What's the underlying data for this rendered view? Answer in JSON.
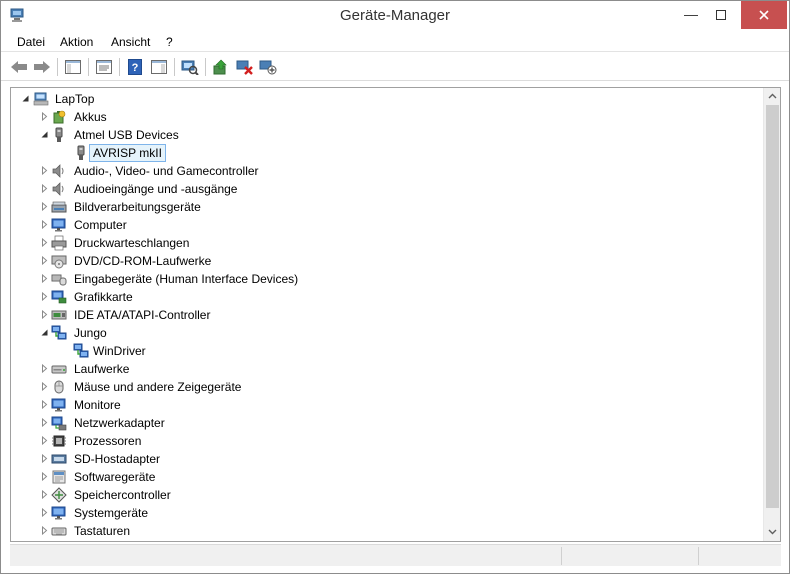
{
  "window": {
    "title": "Geräte-Manager",
    "accent": "#c75050"
  },
  "menu": [
    {
      "label": "Datei"
    },
    {
      "label": "Aktion"
    },
    {
      "label": "Ansicht"
    },
    {
      "label": "?"
    }
  ],
  "toolbar": [
    {
      "name": "back-arrow-icon"
    },
    {
      "name": "forward-arrow-icon"
    },
    {
      "name": "show-hide-console-tree-icon"
    },
    {
      "name": "properties-icon"
    },
    {
      "name": "help-icon"
    },
    {
      "name": "action-pane-icon"
    },
    {
      "name": "scan-hardware-icon"
    },
    {
      "name": "update-driver-icon"
    },
    {
      "name": "uninstall-device-icon"
    },
    {
      "name": "add-legacy-hardware-icon"
    }
  ],
  "tree": [
    {
      "label": "LapTop",
      "level": 0,
      "state": "expanded",
      "icon": "computer-icon"
    },
    {
      "label": "Akkus",
      "level": 1,
      "state": "collapsed",
      "icon": "battery-icon"
    },
    {
      "label": "Atmel USB Devices",
      "level": 1,
      "state": "expanded",
      "icon": "usb-device-icon"
    },
    {
      "label": "AVRISP mkII",
      "level": 2,
      "state": "leaf",
      "icon": "usb-device-icon",
      "selected": true
    },
    {
      "label": "Audio-, Video- und Gamecontroller",
      "level": 1,
      "state": "collapsed",
      "icon": "speaker-icon"
    },
    {
      "label": "Audioeingänge und -ausgänge",
      "level": 1,
      "state": "collapsed",
      "icon": "speaker-icon"
    },
    {
      "label": "Bildverarbeitungsgeräte",
      "level": 1,
      "state": "collapsed",
      "icon": "scanner-icon"
    },
    {
      "label": "Computer",
      "level": 1,
      "state": "collapsed",
      "icon": "monitor-icon"
    },
    {
      "label": "Druckwarteschlangen",
      "level": 1,
      "state": "collapsed",
      "icon": "printer-icon"
    },
    {
      "label": "DVD/CD-ROM-Laufwerke",
      "level": 1,
      "state": "collapsed",
      "icon": "disc-drive-icon"
    },
    {
      "label": "Eingabegeräte (Human Interface Devices)",
      "level": 1,
      "state": "collapsed",
      "icon": "hid-icon"
    },
    {
      "label": "Grafikkarte",
      "level": 1,
      "state": "collapsed",
      "icon": "display-adapter-icon"
    },
    {
      "label": "IDE ATA/ATAPI-Controller",
      "level": 1,
      "state": "collapsed",
      "icon": "ide-controller-icon"
    },
    {
      "label": "Jungo",
      "level": 1,
      "state": "expanded",
      "icon": "network-device-icon"
    },
    {
      "label": "WinDriver",
      "level": 2,
      "state": "leaf",
      "icon": "network-device-icon"
    },
    {
      "label": "Laufwerke",
      "level": 1,
      "state": "collapsed",
      "icon": "disk-drive-icon"
    },
    {
      "label": "Mäuse und andere Zeigegeräte",
      "level": 1,
      "state": "collapsed",
      "icon": "mouse-icon"
    },
    {
      "label": "Monitore",
      "level": 1,
      "state": "collapsed",
      "icon": "monitor-icon"
    },
    {
      "label": "Netzwerkadapter",
      "level": 1,
      "state": "collapsed",
      "icon": "network-adapter-icon"
    },
    {
      "label": "Prozessoren",
      "level": 1,
      "state": "collapsed",
      "icon": "processor-icon"
    },
    {
      "label": "SD-Hostadapter",
      "level": 1,
      "state": "collapsed",
      "icon": "sd-host-icon"
    },
    {
      "label": "Softwaregeräte",
      "level": 1,
      "state": "collapsed",
      "icon": "software-device-icon"
    },
    {
      "label": "Speichercontroller",
      "level": 1,
      "state": "collapsed",
      "icon": "storage-controller-icon"
    },
    {
      "label": "Systemgeräte",
      "level": 1,
      "state": "collapsed",
      "icon": "monitor-icon"
    },
    {
      "label": "Tastaturen",
      "level": 1,
      "state": "collapsed",
      "icon": "keyboard-icon"
    }
  ],
  "status": {
    "text": ""
  }
}
